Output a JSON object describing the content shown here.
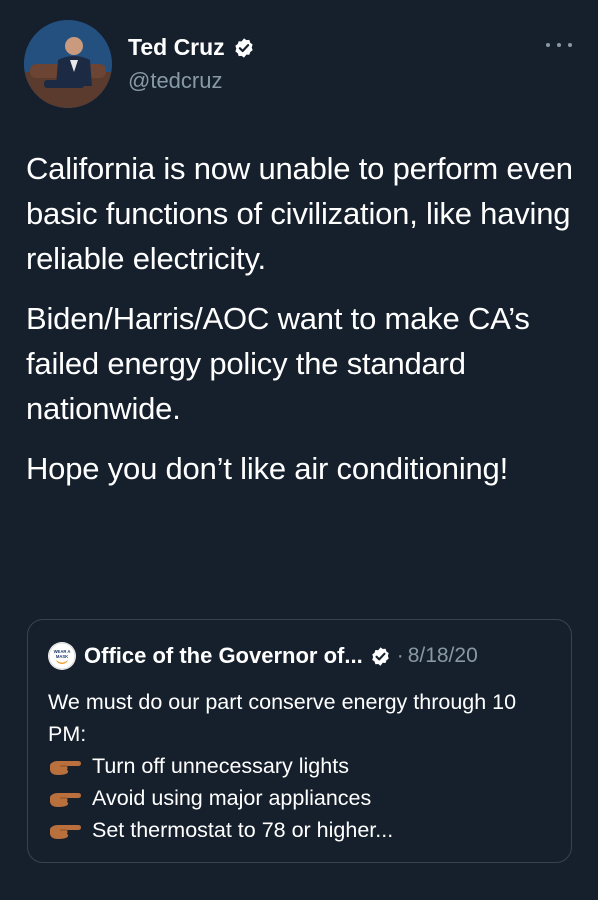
{
  "author": {
    "display_name": "Ted Cruz",
    "handle": "@tedcruz",
    "verified_icon": "verified-badge-icon",
    "avatar_icon": "profile-photo"
  },
  "more_icon": "more-options-icon",
  "tweet": {
    "paragraphs": [
      "California is now unable to perform even basic functions of civilization, like having reliable electricity.",
      "Biden/Harris/AOC want to make CA’s failed energy policy the standard nationwide.",
      "Hope you don’t like air conditioning!"
    ]
  },
  "quoted_tweet": {
    "avatar_text": "WEAR A MASK",
    "author_name": "Office of the Governor of...",
    "separator": "·",
    "date": "8/18/20",
    "intro": "We must do our part conserve energy through 10 PM:",
    "bullet_icon": "pointing-hand-icon",
    "bullets": [
      "Turn off unnecessary lights",
      "Avoid using major appliances",
      "Set thermostat to 78 or higher..."
    ]
  },
  "colors": {
    "background": "#16202c",
    "text": "#ffffff",
    "secondary_text": "#8899a6",
    "border": "#38444d",
    "verified": "#ffffff"
  }
}
